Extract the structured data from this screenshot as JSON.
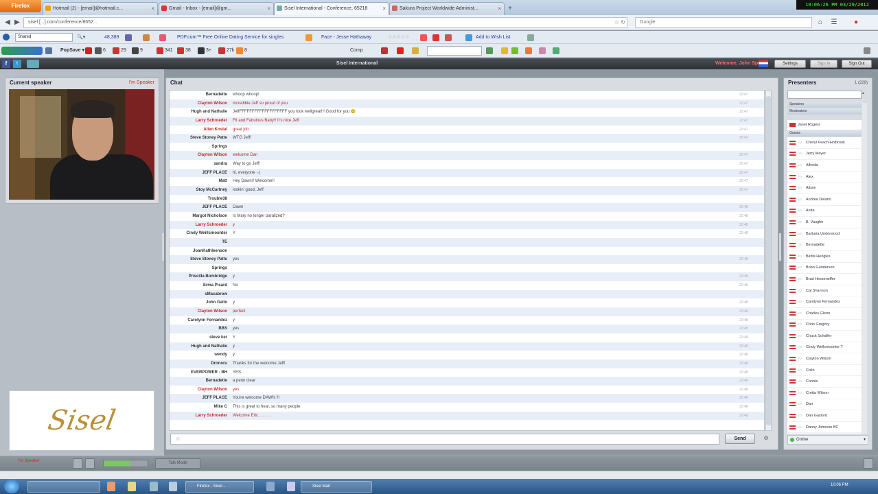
{
  "browser": {
    "menu_button": "Firefox",
    "tabs": [
      {
        "label": "Hotmail (2) - [email]@hotmail.c...",
        "fav": "#f3a000"
      },
      {
        "label": "Gmail - Inbox - [email]@gm...",
        "fav": "#d33"
      },
      {
        "label": "Sisel International - Conference, 65218",
        "fav": "#7aa"
      },
      {
        "label": "Sakura Project Worldwide Administ...",
        "fav": "#c66"
      }
    ],
    "new_tab": "+",
    "clock": "10:06:26 PM 03/29/2012",
    "url": "sisel.[...].com/conference/8652...",
    "search_placeholder": "Google",
    "toolbar1": {
      "search_box": "Shared",
      "count": "48,389",
      "dating_link": "PDF.com™ Free Online Dating Service for singles",
      "face": "Face - Jesse Hathaway",
      "wishlist": "Add to Wish List"
    },
    "toolbar2": {
      "counts": [
        "6",
        "29",
        "9",
        "341",
        "38",
        "3+",
        "27k",
        "8"
      ],
      "comp": "Comp"
    }
  },
  "app": {
    "title": "Sisel International",
    "welcome": "Welcome, John Sp...",
    "buttons": [
      "Settings",
      "Sign In",
      "Sign Out"
    ],
    "speaker_panel": {
      "title": "Current speaker",
      "action": "I'm Speaker"
    },
    "logo_text": "Sisel",
    "chat": {
      "title": "Chat",
      "messages": [
        {
          "name": "Bernadette",
          "text": "whoop whoop!",
          "red": false,
          "time": "22:47"
        },
        {
          "name": "Clayton Wilson",
          "text": "incredible Jeff so proud of you",
          "red": true,
          "time": "22:47"
        },
        {
          "name": "Hugh and Nathalie",
          "text": "JeffFFFFFFFFFFFFFFFFFFF you look wellgreat!!! Good for you 😊",
          "red": false,
          "time": "22:47"
        },
        {
          "name": "Larry Schroeder",
          "text": "Fit and Fabulous Baby!! It's nice Jeff",
          "red": true,
          "time": "22:47"
        },
        {
          "name": "Allen Kostal",
          "text": "great job",
          "red": true,
          "time": "22:47"
        },
        {
          "name": "Steve Stoney Patte",
          "text": "WTG Jeff!",
          "red": false,
          "time": "22:47"
        },
        {
          "name": "Springs",
          "text": "",
          "red": false,
          "time": ""
        },
        {
          "name": "Clayton Wilson",
          "text": "welcome Dan",
          "red": true,
          "time": "22:47"
        },
        {
          "name": "sandra",
          "text": "Way to go Jeff!",
          "red": false,
          "time": "22:47"
        },
        {
          "name": "JEFF PLACE",
          "text": "hi, everyone :-)",
          "red": false,
          "time": "22:47"
        },
        {
          "name": "Matt",
          "text": "Hey Dawn!! Welcome!!",
          "red": false,
          "time": "22:47"
        },
        {
          "name": "Stoy McCartney",
          "text": "lookin' good, Jeff",
          "red": false,
          "time": "22:47"
        },
        {
          "name": "Trouble38",
          "text": "",
          "red": false,
          "time": ""
        },
        {
          "name": "JEFF PLACE",
          "text": "Dawn",
          "red": false,
          "time": "22:48"
        },
        {
          "name": "Margot Nicholson",
          "text": "Is Mary no longer paralized?",
          "red": false,
          "time": "22:48"
        },
        {
          "name": "Larry Schroeder",
          "text": "y",
          "red": true,
          "time": "22:48"
        },
        {
          "name": "Cindy Weillsmounter",
          "text": "Y",
          "red": false,
          "time": "22:48"
        },
        {
          "name": "TE",
          "text": "",
          "red": false,
          "time": ""
        },
        {
          "name": "JoanKathleenson",
          "text": "",
          "red": false,
          "time": ""
        },
        {
          "name": "Steve Stoney Patte",
          "text": "yes",
          "red": false,
          "time": "22:48"
        },
        {
          "name": "Springs",
          "text": "",
          "red": false,
          "time": ""
        },
        {
          "name": "Priscilla Bombridge",
          "text": "y",
          "red": false,
          "time": "22:48"
        },
        {
          "name": "Erma Picard",
          "text": "No",
          "red": false,
          "time": "22:48"
        },
        {
          "name": "sMacabrow",
          "text": "",
          "red": false,
          "time": ""
        },
        {
          "name": "John Gallo",
          "text": "y",
          "red": false,
          "time": "22:48"
        },
        {
          "name": "Clayton Wilson",
          "text": "perfect",
          "red": true,
          "time": "22:48"
        },
        {
          "name": "Carolynn Fernandez",
          "text": "y",
          "red": false,
          "time": "22:48"
        },
        {
          "name": "BBS",
          "text": "yes",
          "red": false,
          "time": "22:48"
        },
        {
          "name": "steve ker",
          "text": "Y",
          "red": false,
          "time": "22:48"
        },
        {
          "name": "Hugh and Nathalie",
          "text": "y",
          "red": false,
          "time": "22:48"
        },
        {
          "name": "wendy",
          "text": "y",
          "red": false,
          "time": "22:48"
        },
        {
          "name": "Dronoru",
          "text": "Thanks for the welcome Jeff!",
          "red": false,
          "time": "22:48"
        },
        {
          "name": "EVERPOWER - BH",
          "text": "YES",
          "red": false,
          "time": "22:48"
        },
        {
          "name": "Bernadette",
          "text": "a penn clear",
          "red": false,
          "time": "22:48"
        },
        {
          "name": "Clayton Wilson",
          "text": "yes",
          "red": true,
          "time": "22:48"
        },
        {
          "name": "JEFF PLACE",
          "text": "You're welcome DAWN !!!",
          "red": false,
          "time": "22:48"
        },
        {
          "name": "Mike C",
          "text": "This is great to hear, so many people",
          "red": false,
          "time": "22:48"
        },
        {
          "name": "Larry Schroeder",
          "text": "Welcome Eric. . . . . .",
          "red": true,
          "time": "22:48"
        }
      ],
      "send": "Send"
    },
    "presenters": {
      "title": "Presenters",
      "count": "1 (229)",
      "sections": [
        "Speakers",
        "Moderators",
        "Guests"
      ],
      "host": "Janet Rogers",
      "people": [
        "Cheryl Peach-Holbrook",
        "Jerry Meyer",
        "Alfreda",
        "Alex",
        "Alison",
        "Andrea Delano",
        "Anita",
        "B. Vaughn",
        "Barbara Underwood",
        "Bernadette",
        "Bettis Hengles",
        "Brian Gunderson",
        "Brad Hesseneffer",
        "Cal Shannon",
        "Carolynn Fernandez",
        "Charles Glenn",
        "Chris Gregory",
        "Chuck Schaffer",
        "Cindy Wellsmounter T",
        "Clayton Wilson",
        "Colin",
        "Connie",
        "Cretta Wilson",
        "Dan",
        "Dan Gaylord",
        "Danny Johnson BC"
      ],
      "footer": "Online"
    },
    "bottom": {
      "action": "I'm Speaker",
      "status": "Talk Mode"
    }
  },
  "taskbar": {
    "items": [
      "",
      "Firefox - Sisel...",
      "",
      "Sisel Mail"
    ],
    "clock": "10:06 PM"
  }
}
